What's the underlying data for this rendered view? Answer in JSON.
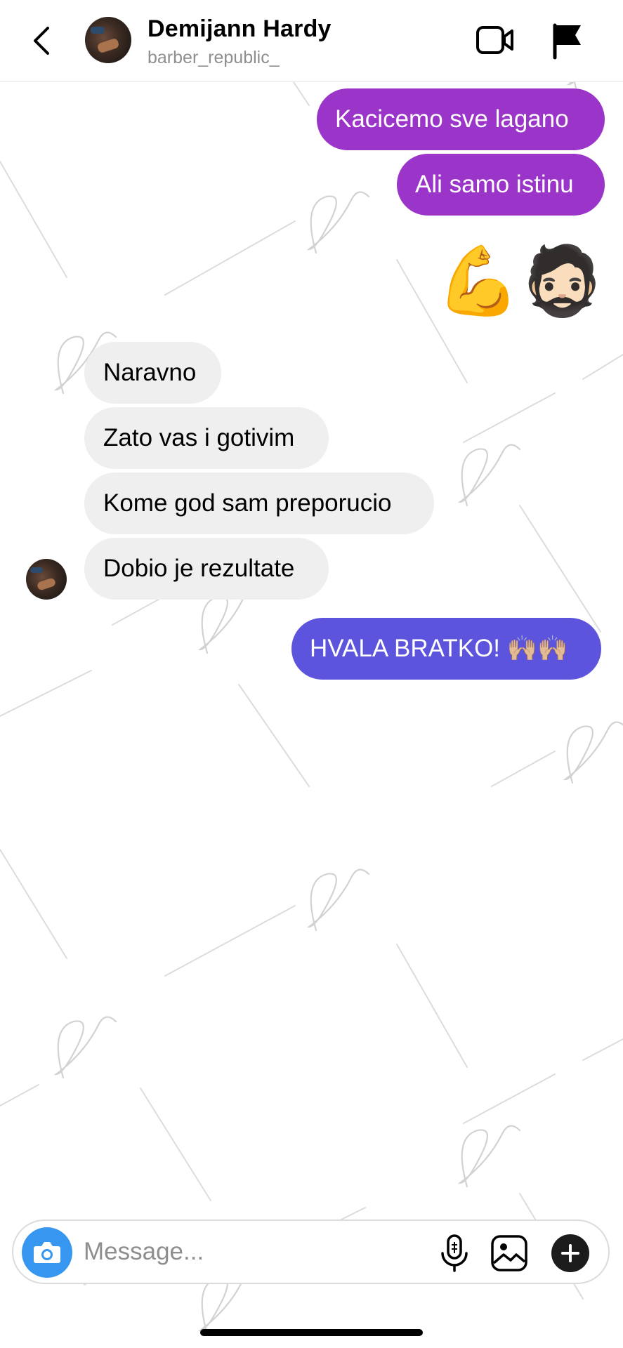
{
  "header": {
    "name": "Demijann Hardy",
    "username": "barber_republic_",
    "back_icon": "chevron-left-icon",
    "video_icon": "video-camera-icon",
    "flag_icon": "flag-icon"
  },
  "messages": [
    {
      "direction": "outgoing",
      "text": "Kacicemo sve lagano"
    },
    {
      "direction": "outgoing",
      "text": "Ali samo istinu"
    },
    {
      "direction": "outgoing",
      "text": "💪🧔🏻"
    },
    {
      "direction": "incoming",
      "text": "Naravno"
    },
    {
      "direction": "incoming",
      "text": "Zato vas i gotivim"
    },
    {
      "direction": "incoming",
      "text": "Kome god sam preporucio"
    },
    {
      "direction": "incoming",
      "text": "Dobio je rezultate"
    },
    {
      "direction": "outgoing",
      "text": "HVALA BRATKO! 🙌🏼🙌🏼"
    }
  ],
  "composer": {
    "placeholder": "Message...",
    "camera_icon": "camera-icon",
    "mic_icon": "microphone-icon",
    "gallery_icon": "gallery-icon",
    "plus_icon": "plus-icon"
  },
  "colors": {
    "outgoing_purple": "#9b34c9",
    "outgoing_blue": "#5c54dc",
    "incoming_gray": "#efefef",
    "camera_blue": "#3797f0"
  }
}
